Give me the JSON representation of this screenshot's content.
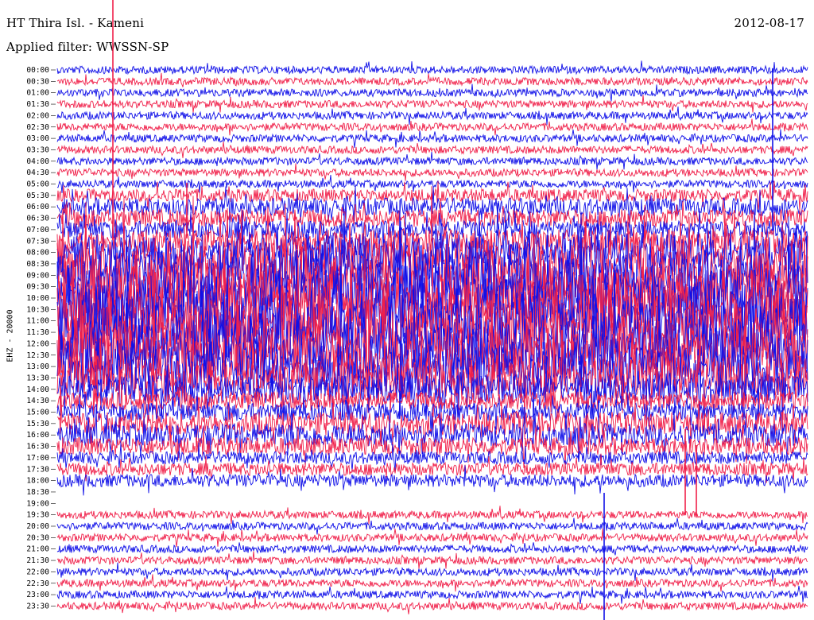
{
  "header": {
    "station": "HT Thira Isl. - Kameni",
    "date": "2012-08-17",
    "filter": "Applied filter: WWSSN-SP"
  },
  "channel_label": "EHZ - 20000",
  "colors": {
    "trace_a": "#1010e8",
    "trace_b": "#f0204a"
  },
  "chart_data": {
    "type": "line",
    "title": "HT Thira Isl. - Kameni",
    "ylabel": "EHZ - 20000",
    "row_labels": [
      "00:00",
      "00:30",
      "01:00",
      "01:30",
      "02:00",
      "02:30",
      "03:00",
      "03:30",
      "04:00",
      "04:30",
      "05:00",
      "05:30",
      "06:00",
      "06:30",
      "07:00",
      "07:30",
      "08:00",
      "08:30",
      "09:00",
      "09:30",
      "10:00",
      "10:30",
      "11:00",
      "11:30",
      "12:00",
      "12:30",
      "13:00",
      "13:30",
      "14:00",
      "14:30",
      "15:00",
      "15:30",
      "16:00",
      "16:30",
      "17:00",
      "17:30",
      "18:00",
      "18:30",
      "19:00",
      "19:30",
      "20:00",
      "20:30",
      "21:00",
      "21:30",
      "22:00",
      "22:30",
      "23:00",
      "23:30"
    ],
    "row_activity": [
      1,
      1,
      1,
      1,
      1,
      1,
      1,
      1,
      1,
      1,
      1,
      2,
      3,
      3,
      3,
      4,
      6,
      8,
      9,
      9,
      10,
      10,
      10,
      10,
      10,
      9,
      8,
      7,
      5,
      3,
      3,
      4,
      4,
      3,
      2,
      2,
      2,
      0,
      0,
      1,
      1,
      1,
      1,
      1,
      1,
      1,
      1,
      1
    ],
    "gap_rows": [
      "18:30",
      "19:00"
    ]
  }
}
